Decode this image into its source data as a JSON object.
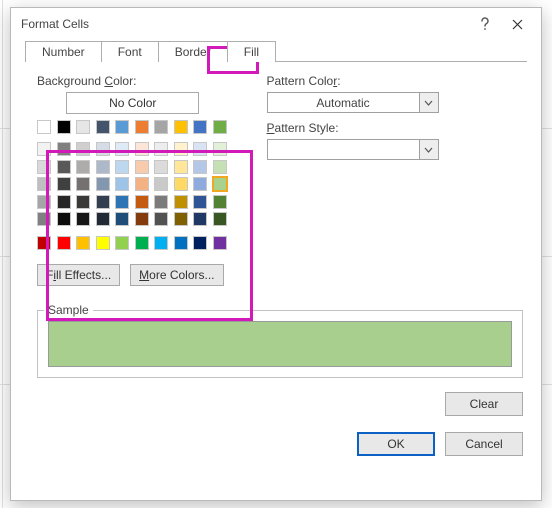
{
  "window": {
    "title": "Format Cells"
  },
  "tabs": {
    "items": [
      {
        "label": "Number"
      },
      {
        "label": "Font"
      },
      {
        "label": "Border"
      },
      {
        "label": "Fill"
      }
    ]
  },
  "fill": {
    "bg_label_pre": "Background ",
    "bg_label_key": "C",
    "bg_label_post": "olor:",
    "no_color": "No Color",
    "theme_rows": [
      [
        "#ffffff",
        "#000000",
        "#e7e6e6",
        "#44546a",
        "#5b9bd5",
        "#ed7d31",
        "#a5a5a5",
        "#ffc000",
        "#4472c4",
        "#70ad47"
      ],
      [
        "#f2f2f2",
        "#808080",
        "#d0cece",
        "#d6dce5",
        "#deebf7",
        "#fbe5d6",
        "#ededed",
        "#fff2cc",
        "#dae3f3",
        "#e2f0d9"
      ],
      [
        "#d9d9d9",
        "#595959",
        "#aeabab",
        "#adb9ca",
        "#bdd7ee",
        "#f8cbad",
        "#dbdbdb",
        "#ffe699",
        "#b4c7e7",
        "#c5e0b4"
      ],
      [
        "#bfbfbf",
        "#404040",
        "#757171",
        "#8497b0",
        "#9dc3e6",
        "#f4b183",
        "#c9c9c9",
        "#ffd966",
        "#8faadc",
        "#a9d18e"
      ],
      [
        "#a6a6a6",
        "#262626",
        "#3b3838",
        "#333f50",
        "#2e75b6",
        "#c55a11",
        "#7b7b7b",
        "#bf9000",
        "#2f5597",
        "#548235"
      ],
      [
        "#808080",
        "#0d0d0d",
        "#171717",
        "#222a35",
        "#1f4e79",
        "#843c0c",
        "#525252",
        "#806000",
        "#203864",
        "#385723"
      ]
    ],
    "standard_colors": [
      "#c00000",
      "#ff0000",
      "#ffc000",
      "#ffff00",
      "#92d050",
      "#00b050",
      "#00b0f0",
      "#0070c0",
      "#002060",
      "#7030a0"
    ],
    "selected_color": "#a9d18e",
    "fill_effects_pre": "F",
    "fill_effects_key": "i",
    "fill_effects_post": "ll Effects...",
    "more_colors_key": "M",
    "more_colors_post": "ore Colors..."
  },
  "pattern": {
    "color_label_pre": "Pattern Colo",
    "color_label_key": "r",
    "color_label_post": ":",
    "color_value": "Automatic",
    "style_label_pre": "",
    "style_label_key": "P",
    "style_label_post": "attern Style:",
    "style_value": ""
  },
  "sample": {
    "label": "Sample",
    "color": "#a8cf8e"
  },
  "buttons": {
    "clear": "Clear",
    "ok": "OK",
    "cancel": "Cancel"
  }
}
